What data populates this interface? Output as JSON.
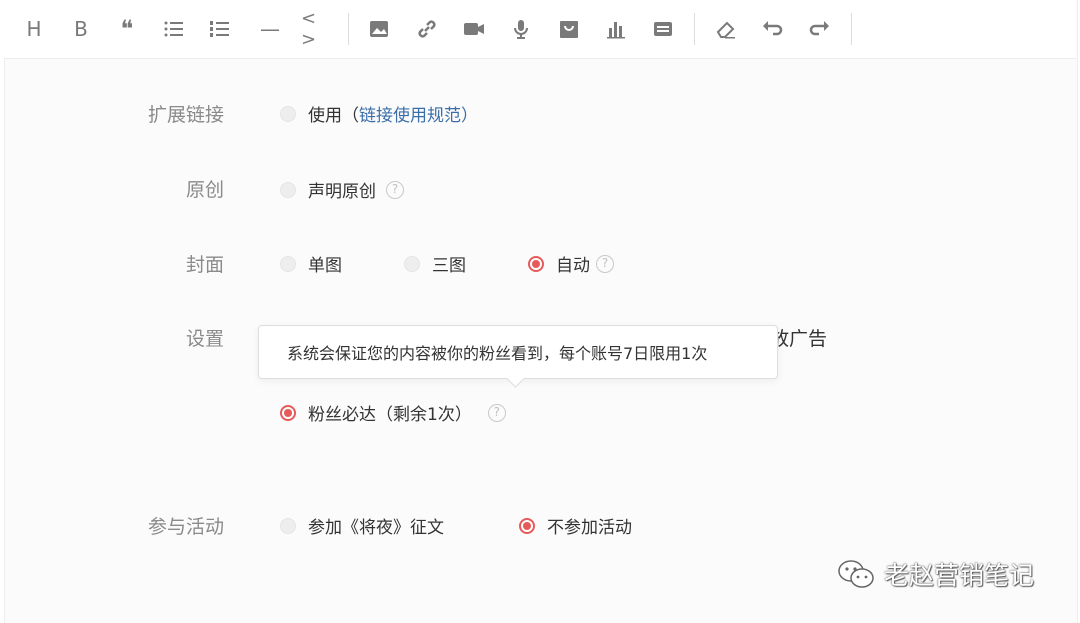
{
  "toolbar": {
    "heading_glyph": "H",
    "bold_glyph": "B",
    "quote_glyph": "❝",
    "hr_glyph": "—",
    "code_glyph": "< >"
  },
  "rows": {
    "extended_link": {
      "label": "扩展链接",
      "option": "使用（",
      "link": "链接使用规范",
      "close": "）"
    },
    "original": {
      "label": "原创",
      "option": "声明原创"
    },
    "cover": {
      "label": "封面",
      "options": [
        "单图",
        "三图",
        "自动"
      ],
      "selected": "自动"
    },
    "settings": {
      "label": "设置",
      "hidden_tail": "放广告",
      "fans_option": "粉丝必达（剩余1次）",
      "tooltip": "系统会保证您的内容被你的粉丝看到，每个账号7日限用1次"
    },
    "activity": {
      "label": "参与活动",
      "options": [
        "参加《将夜》征文",
        "不参加活动"
      ],
      "selected": "不参加活动"
    }
  },
  "help_glyph": "?",
  "watermark": {
    "text": "老赵营销笔记"
  },
  "colors": {
    "accent": "#e65a5a",
    "link": "#3b6ea8",
    "label": "#8a8a8a"
  }
}
